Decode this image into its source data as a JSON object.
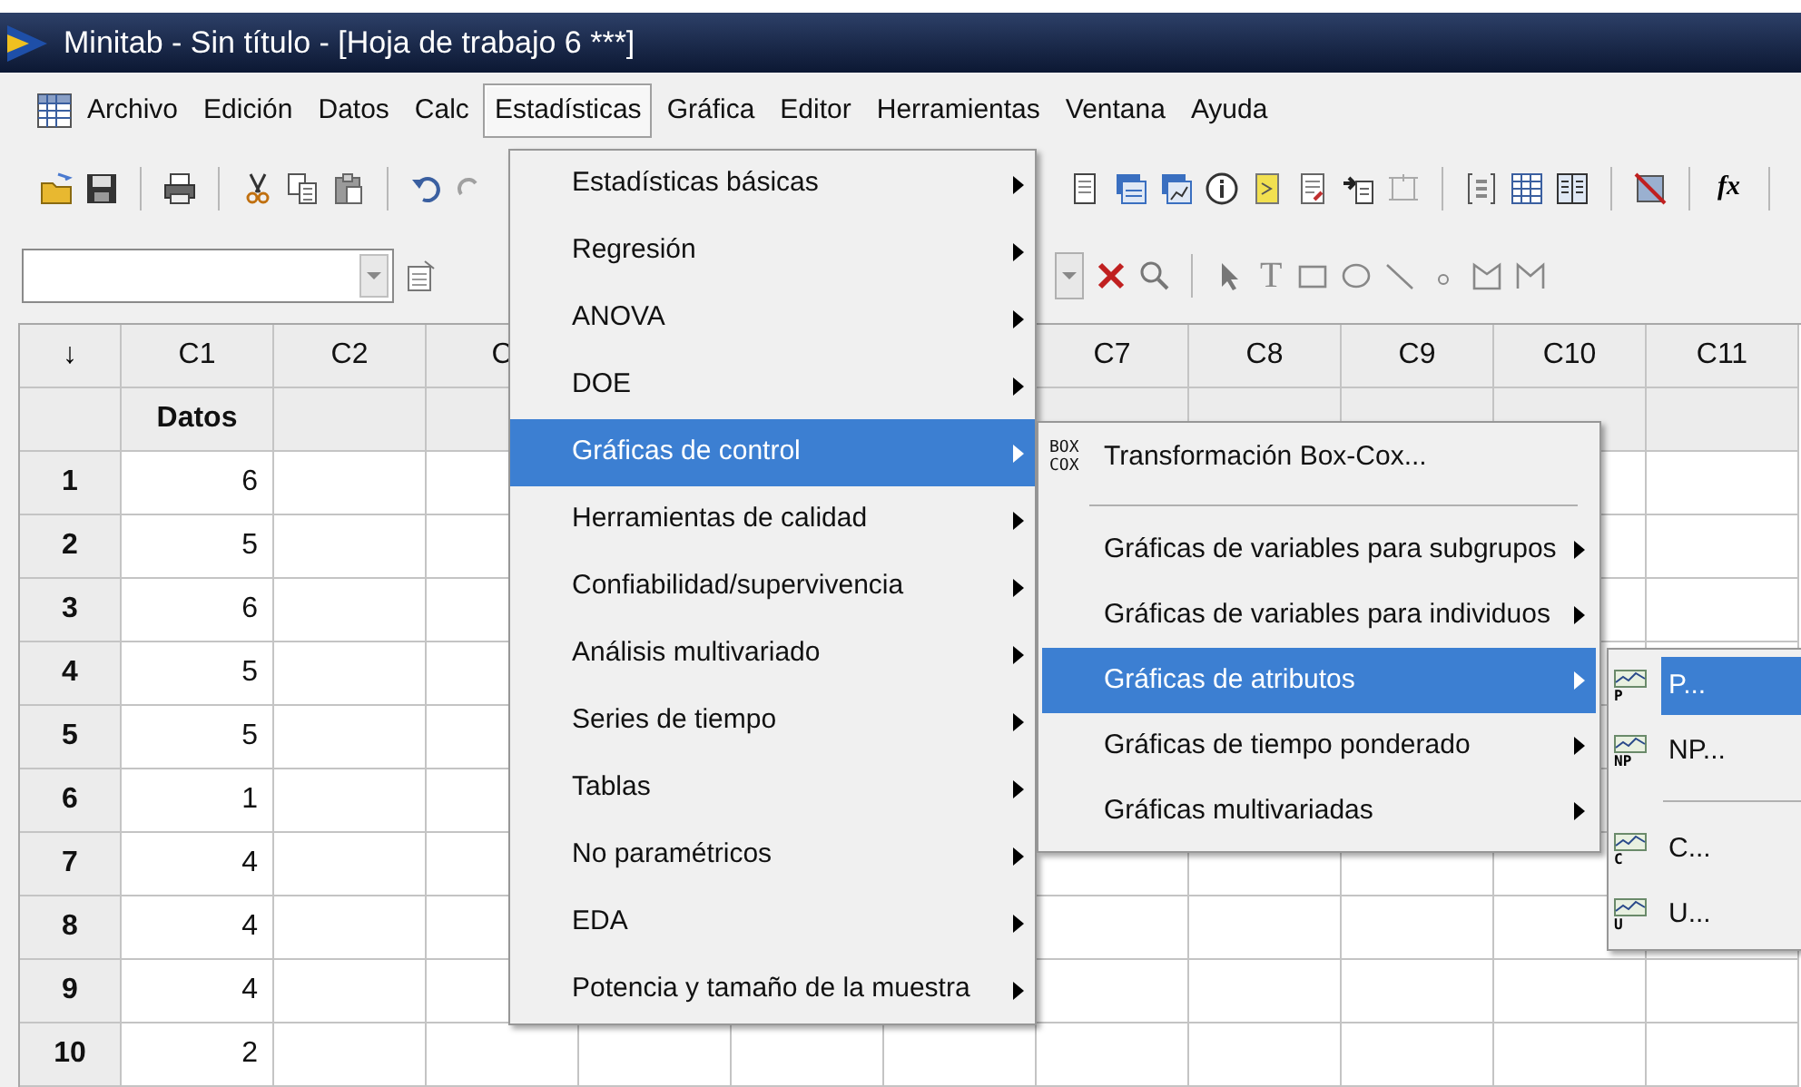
{
  "window": {
    "title": "Minitab - Sin título - [Hoja de trabajo 6 ***]"
  },
  "menu_bar": [
    {
      "label": "Archivo",
      "selected": false
    },
    {
      "label": "Edición",
      "selected": false
    },
    {
      "label": "Datos",
      "selected": false
    },
    {
      "label": "Calc",
      "selected": false
    },
    {
      "label": "Estadísticas",
      "selected": true
    },
    {
      "label": "Gráfica",
      "selected": false
    },
    {
      "label": "Editor",
      "selected": false
    },
    {
      "label": "Herramientas",
      "selected": false
    },
    {
      "label": "Ventana",
      "selected": false
    },
    {
      "label": "Ayuda",
      "selected": false
    }
  ],
  "toolbar": {
    "function_button": "fx",
    "text_tool": "T"
  },
  "worksheet": {
    "corner": "↓",
    "columns_left": [
      "C1",
      "C2",
      "C"
    ],
    "columns_right": [
      "C7",
      "C8",
      "C9",
      "C10",
      "C11"
    ],
    "names": [
      "Datos"
    ],
    "rows": [
      {
        "number": "1",
        "values": [
          "6"
        ]
      },
      {
        "number": "2",
        "values": [
          "5"
        ]
      },
      {
        "number": "3",
        "values": [
          "6"
        ]
      },
      {
        "number": "4",
        "values": [
          "5"
        ]
      },
      {
        "number": "5",
        "values": [
          "5"
        ]
      },
      {
        "number": "6",
        "values": [
          "1"
        ]
      },
      {
        "number": "7",
        "values": [
          "4"
        ]
      },
      {
        "number": "8",
        "values": [
          "4"
        ]
      },
      {
        "number": "9",
        "values": [
          "4"
        ]
      },
      {
        "number": "10",
        "values": [
          "2"
        ]
      }
    ]
  },
  "stats_menu": [
    {
      "label": "Estadísticas básicas",
      "submenu": true,
      "selected": false
    },
    {
      "label": "Regresión",
      "submenu": true,
      "selected": false
    },
    {
      "label": "ANOVA",
      "submenu": true,
      "selected": false
    },
    {
      "label": "DOE",
      "submenu": true,
      "selected": false
    },
    {
      "label": "Gráficas de control",
      "submenu": true,
      "selected": true
    },
    {
      "label": "Herramientas de calidad",
      "submenu": true,
      "selected": false
    },
    {
      "label": "Confiabilidad/supervivencia",
      "submenu": true,
      "selected": false
    },
    {
      "label": "Análisis multivariado",
      "submenu": true,
      "selected": false
    },
    {
      "label": "Series de tiempo",
      "submenu": true,
      "selected": false
    },
    {
      "label": "Tablas",
      "submenu": true,
      "selected": false
    },
    {
      "label": "No paramétricos",
      "submenu": true,
      "selected": false
    },
    {
      "label": "EDA",
      "submenu": true,
      "selected": false
    },
    {
      "label": "Potencia y tamaño de la muestra",
      "submenu": true,
      "selected": false
    }
  ],
  "control_charts_menu": [
    {
      "kind": "item",
      "label": "Transformación Box-Cox...",
      "icon_text": [
        "BOX",
        "COX"
      ],
      "submenu": false,
      "selected": false
    },
    {
      "kind": "separator"
    },
    {
      "kind": "item",
      "label": "Gráficas de variables para subgrupos",
      "submenu": true,
      "selected": false
    },
    {
      "kind": "item",
      "label": "Gráficas de variables para individuos",
      "submenu": true,
      "selected": false
    },
    {
      "kind": "item",
      "label": "Gráficas de atributos",
      "submenu": true,
      "selected": true
    },
    {
      "kind": "item",
      "label": "Gráficas de tiempo ponderado",
      "submenu": true,
      "selected": false
    },
    {
      "kind": "item",
      "label": "Gráficas multivariadas",
      "submenu": true,
      "selected": false
    }
  ],
  "attribute_charts_menu": [
    {
      "kind": "item",
      "label": "P...",
      "icon_text": "P",
      "selected": true
    },
    {
      "kind": "item",
      "label": "NP...",
      "icon_text": "NP",
      "selected": false
    },
    {
      "kind": "separator"
    },
    {
      "kind": "item",
      "label": "C...",
      "icon_text": "C",
      "selected": false
    },
    {
      "kind": "item",
      "label": "U...",
      "icon_text": "U",
      "selected": false
    }
  ]
}
